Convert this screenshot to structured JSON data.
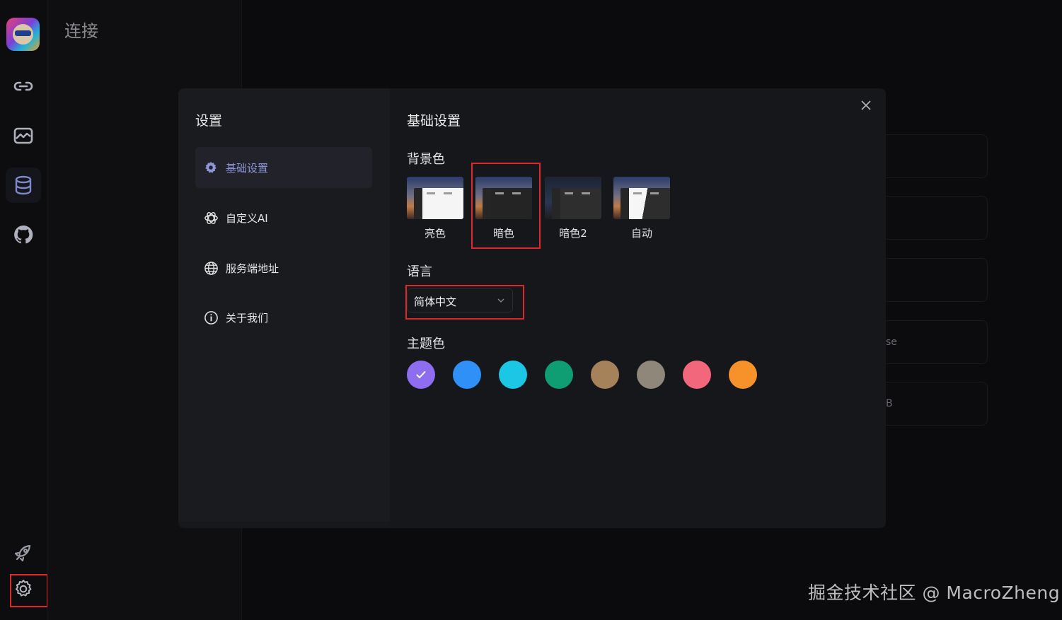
{
  "page": {
    "title": "连接"
  },
  "background_rows": [
    {
      "text": ""
    },
    {
      "text": ""
    },
    {
      "text": ""
    },
    {
      "text": "se"
    },
    {
      "text": "B"
    }
  ],
  "rail": {
    "items": [
      {
        "icon": "link-icon"
      },
      {
        "icon": "chart-icon"
      },
      {
        "icon": "database-icon"
      },
      {
        "icon": "github-icon"
      },
      {
        "icon": "rocket-icon"
      },
      {
        "icon": "gear-icon"
      }
    ]
  },
  "dialog": {
    "title": "设置",
    "menu": [
      {
        "label": "基础设置",
        "icon": "gear-icon",
        "active": true
      },
      {
        "label": "自定义AI",
        "icon": "openai-icon",
        "active": false
      },
      {
        "label": "服务端地址",
        "icon": "globe-icon",
        "active": false
      },
      {
        "label": "关于我们",
        "icon": "info-icon",
        "active": false
      }
    ],
    "main": {
      "section_title": "基础设置",
      "bg_label": "背景色",
      "themes": [
        {
          "name": "亮色",
          "style": "light"
        },
        {
          "name": "暗色",
          "style": "dark",
          "selected": true
        },
        {
          "name": "暗色2",
          "style": "dark2"
        },
        {
          "name": "自动",
          "style": "auto"
        }
      ],
      "lang_label": "语言",
      "lang_value": "简体中文",
      "color_label": "主题色",
      "colors": [
        "#8f6df0",
        "#2f91f7",
        "#1cc7e6",
        "#0f9e74",
        "#a5825a",
        "#8f877a",
        "#f2677b",
        "#f7912a"
      ],
      "selected_color": 0
    }
  },
  "watermark": "掘金技术社区 @ MacroZheng"
}
